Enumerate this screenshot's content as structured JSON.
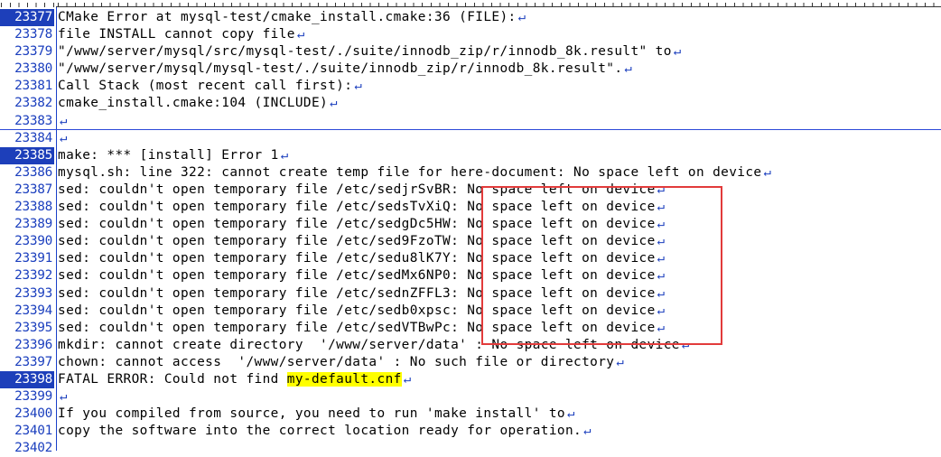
{
  "lines": [
    {
      "num": "23377",
      "pre": "CMake Error at mysql-test/cmake_install.cmake:36 (FILE):",
      "mark": "",
      "post": "",
      "hl": true
    },
    {
      "num": "23378",
      "pre": "file INSTALL cannot copy file",
      "mark": "",
      "post": "",
      "hl": false
    },
    {
      "num": "23379",
      "pre": "\"/www/server/mysql/src/mysql-test/./suite/innodb_zip/r/innodb_8k.result\" to",
      "mark": "",
      "post": "",
      "hl": false
    },
    {
      "num": "23380",
      "pre": "\"/www/server/mysql/mysql-test/./suite/innodb_zip/r/innodb_8k.result\".",
      "mark": "",
      "post": "",
      "hl": false
    },
    {
      "num": "23381",
      "pre": "Call Stack (most recent call first):",
      "mark": "",
      "post": "",
      "hl": false
    },
    {
      "num": "23382",
      "pre": "cmake_install.cmake:104 (INCLUDE)",
      "mark": "",
      "post": "",
      "hl": false
    },
    {
      "num": "23383",
      "pre": "",
      "mark": "",
      "post": "",
      "hl": false
    },
    {
      "num": "23384",
      "pre": "",
      "mark": "",
      "post": "",
      "hl": false
    },
    {
      "num": "23385",
      "pre": "make: *** [install] Error 1",
      "mark": "",
      "post": "",
      "hl": true
    },
    {
      "num": "23386",
      "pre": "mysql.sh: line 322: cannot create temp file for here-document: No space left on device",
      "mark": "",
      "post": "",
      "hl": false
    },
    {
      "num": "23387",
      "pre": "sed: couldn't open temporary file /etc/sedjrSvBR: No space left on device",
      "mark": "",
      "post": "",
      "hl": false
    },
    {
      "num": "23388",
      "pre": "sed: couldn't open temporary file /etc/sedsTvXiQ: No space left on device",
      "mark": "",
      "post": "",
      "hl": false
    },
    {
      "num": "23389",
      "pre": "sed: couldn't open temporary file /etc/sedgDc5HW: No space left on device",
      "mark": "",
      "post": "",
      "hl": false
    },
    {
      "num": "23390",
      "pre": "sed: couldn't open temporary file /etc/sed9FzoTW: No space left on device",
      "mark": "",
      "post": "",
      "hl": false
    },
    {
      "num": "23391",
      "pre": "sed: couldn't open temporary file /etc/sedu8lK7Y: No space left on device",
      "mark": "",
      "post": "",
      "hl": false
    },
    {
      "num": "23392",
      "pre": "sed: couldn't open temporary file /etc/sedMx6NP0: No space left on device",
      "mark": "",
      "post": "",
      "hl": false
    },
    {
      "num": "23393",
      "pre": "sed: couldn't open temporary file /etc/sednZFFL3: No space left on device",
      "mark": "",
      "post": "",
      "hl": false
    },
    {
      "num": "23394",
      "pre": "sed: couldn't open temporary file /etc/sedb0xpsc: No space left on device",
      "mark": "",
      "post": "",
      "hl": false
    },
    {
      "num": "23395",
      "pre": "sed: couldn't open temporary file /etc/sedVTBwPc: No space left on device",
      "mark": "",
      "post": "",
      "hl": false
    },
    {
      "num": "23396",
      "pre": "mkdir: cannot create directory  '/www/server/data' : No space left on device",
      "mark": "",
      "post": "",
      "hl": false
    },
    {
      "num": "23397",
      "pre": "chown: cannot access  '/www/server/data' : No such file or directory",
      "mark": "",
      "post": "",
      "hl": false
    },
    {
      "num": "23398",
      "pre": "FATAL ERROR: Could not find ",
      "mark": "my-default.cnf",
      "post": "",
      "hl": true
    },
    {
      "num": "23399",
      "pre": "",
      "mark": "",
      "post": "",
      "hl": false
    },
    {
      "num": "23400",
      "pre": "If you compiled from source, you need to run 'make install' to",
      "mark": "",
      "post": "",
      "hl": false
    },
    {
      "num": "23401",
      "pre": "copy the software into the correct location ready for operation.",
      "mark": "",
      "post": "",
      "hl": false
    },
    {
      "num": "23402",
      "pre": "",
      "mark": "",
      "post": "",
      "hl": false
    }
  ],
  "eol_glyph": "↵",
  "colors": {
    "line_number": "#1b3fbe",
    "highlight_bg": "#1d3fba",
    "match": "#ffff00",
    "annotation": "#e23b3b"
  }
}
